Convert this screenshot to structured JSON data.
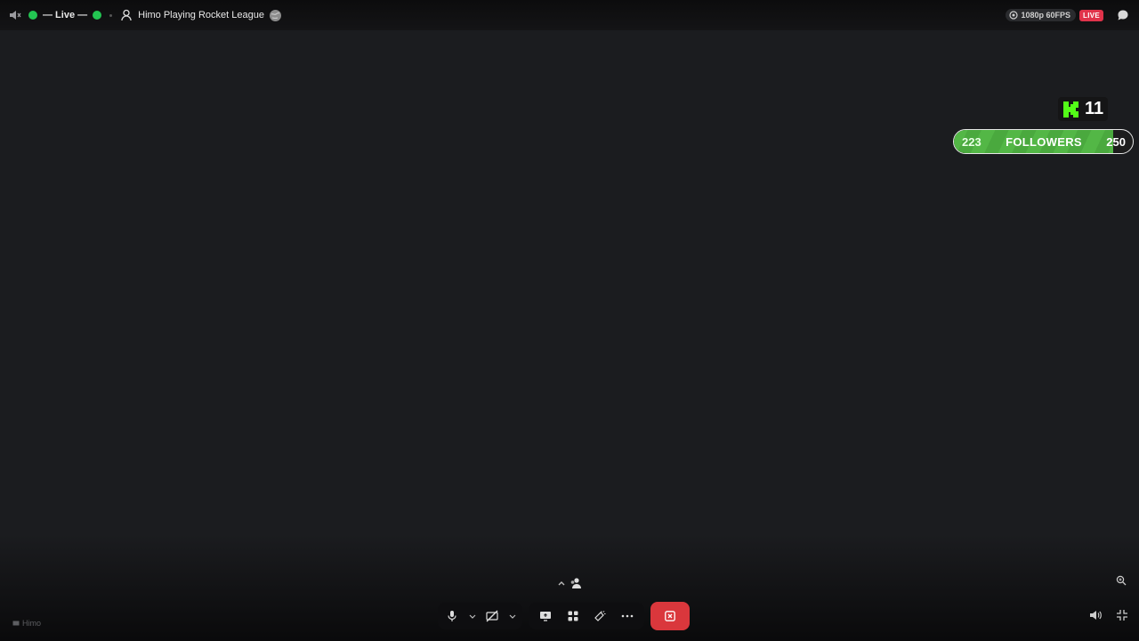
{
  "header": {
    "live_label": "— Live —",
    "stream_title": "Himo Playing Rocket League",
    "quality": "1080p 60FPS",
    "live_badge": "LIVE"
  },
  "overlay": {
    "kick_viewers": "11",
    "followers": {
      "current": "223",
      "label": "FOLLOWERS",
      "goal": "250",
      "progress": 0.892
    }
  },
  "footer": {
    "username": "Himo"
  },
  "colors": {
    "live_green": "#23c552",
    "live_badge_red": "#e0334a",
    "kick_green": "#53fc18",
    "follower_green": "#53b746",
    "leave_red": "#da373c"
  },
  "icons": {
    "top_left": [
      "speaker-muted-icon",
      "user-avatar-icon",
      "globe-avatar-icon"
    ],
    "top_right": [
      "eye-icon",
      "chat-bubble-icon"
    ],
    "controls": [
      "microphone-icon",
      "camera-off-icon",
      "screen-share-icon",
      "activities-icon",
      "soundboard-icon",
      "more-icon",
      "disconnect-icon"
    ],
    "bottom_right": [
      "zoom-icon",
      "volume-icon",
      "exit-fullscreen-icon"
    ]
  }
}
